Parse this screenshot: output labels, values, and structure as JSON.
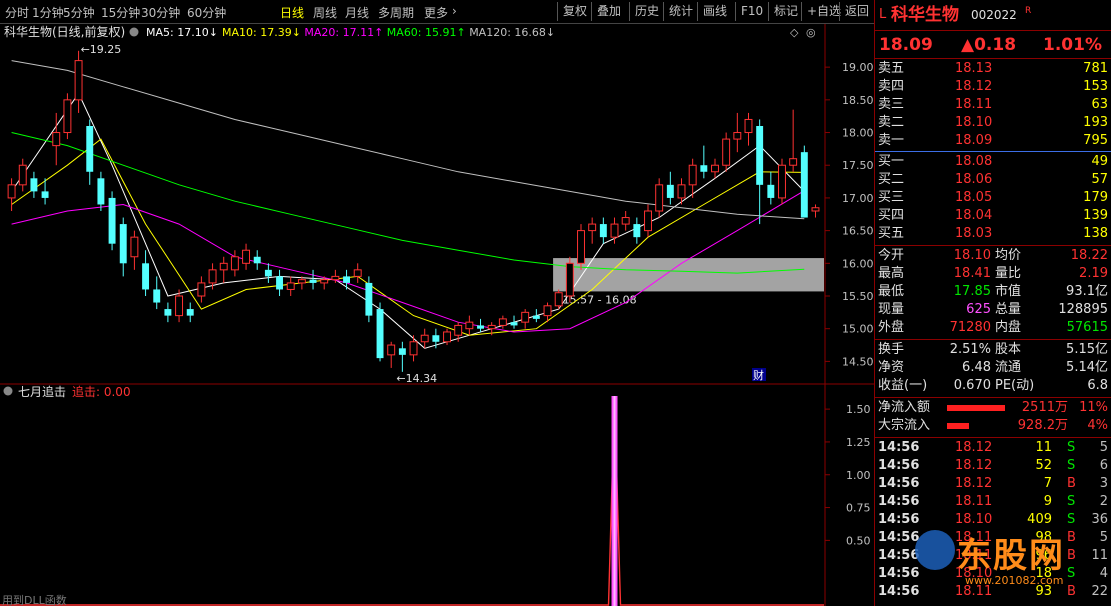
{
  "toolbar": {
    "periods": [
      "分时",
      "1分钟",
      "5分钟",
      "15分钟",
      "30分钟",
      "60分钟",
      "日线",
      "周线",
      "月线",
      "多周期",
      "更多"
    ],
    "active_period": "日线",
    "buttons": [
      "复权",
      "叠加",
      "历史",
      "统计",
      "画线",
      "F10",
      "标记",
      "+自选",
      "返回"
    ]
  },
  "main_chart": {
    "stock_title": "科华生物(日线,前复权)",
    "ma": [
      {
        "label": "MA5: 17.10",
        "color": "#ffffff",
        "arrow": "↓"
      },
      {
        "label": "MA10: 17.39",
        "color": "#ffff00",
        "arrow": "↓"
      },
      {
        "label": "MA20: 17.11",
        "color": "#ff00ff",
        "arrow": "↑"
      },
      {
        "label": "MA60: 15.91",
        "color": "#00ff00",
        "arrow": "↑"
      },
      {
        "label": "MA120: 16.68",
        "color": "#c0c0c0",
        "arrow": "↓"
      }
    ],
    "high_marker": "19.25",
    "low_marker": "14.34",
    "zone_label": "15.57 - 16.08",
    "cai_marker": "财",
    "y_ticks": [
      "19.00",
      "18.50",
      "18.00",
      "17.50",
      "17.00",
      "16.50",
      "16.00",
      "15.50",
      "15.00",
      "14.50"
    ]
  },
  "sub_chart": {
    "name": "七月追击",
    "var_label": "追击: 0.00",
    "y_ticks": [
      "1.50",
      "1.25",
      "1.00",
      "0.75",
      "0.50"
    ],
    "bottom_text": "用到DLL函数"
  },
  "chart_data": {
    "type": "candlestick",
    "ylim": [
      14.2,
      19.4
    ],
    "candles": [
      [
        17.0,
        17.3,
        16.8,
        17.2
      ],
      [
        17.2,
        17.6,
        17.1,
        17.5
      ],
      [
        17.3,
        17.4,
        17.0,
        17.1
      ],
      [
        17.1,
        17.3,
        16.9,
        17.0
      ],
      [
        17.8,
        18.3,
        17.5,
        18.0
      ],
      [
        18.0,
        18.6,
        17.9,
        18.5
      ],
      [
        18.5,
        19.25,
        18.3,
        19.1
      ],
      [
        18.1,
        18.2,
        17.2,
        17.4
      ],
      [
        17.3,
        17.4,
        16.8,
        16.9
      ],
      [
        17.0,
        17.1,
        16.2,
        16.3
      ],
      [
        16.6,
        16.7,
        15.8,
        16.0
      ],
      [
        16.1,
        16.5,
        15.9,
        16.4
      ],
      [
        16.0,
        16.2,
        15.5,
        15.6
      ],
      [
        15.6,
        15.8,
        15.3,
        15.4
      ],
      [
        15.3,
        15.4,
        15.1,
        15.2
      ],
      [
        15.2,
        15.6,
        15.1,
        15.5
      ],
      [
        15.3,
        15.4,
        15.1,
        15.2
      ],
      [
        15.5,
        15.8,
        15.4,
        15.7
      ],
      [
        15.7,
        16.0,
        15.6,
        15.9
      ],
      [
        15.9,
        16.1,
        15.7,
        16.0
      ],
      [
        15.9,
        16.2,
        15.8,
        16.1
      ],
      [
        16.0,
        16.3,
        15.9,
        16.2
      ],
      [
        16.1,
        16.2,
        15.9,
        16.0
      ],
      [
        15.9,
        16.0,
        15.7,
        15.8
      ],
      [
        15.8,
        15.9,
        15.5,
        15.6
      ],
      [
        15.6,
        15.8,
        15.5,
        15.7
      ],
      [
        15.7,
        15.8,
        15.6,
        15.75
      ],
      [
        15.75,
        15.9,
        15.6,
        15.7
      ],
      [
        15.7,
        15.8,
        15.6,
        15.75
      ],
      [
        15.75,
        15.9,
        15.7,
        15.8
      ],
      [
        15.8,
        15.9,
        15.6,
        15.7
      ],
      [
        15.8,
        16.0,
        15.7,
        15.9
      ],
      [
        15.7,
        15.8,
        15.1,
        15.2
      ],
      [
        15.3,
        15.4,
        14.5,
        14.55
      ],
      [
        14.6,
        14.8,
        14.4,
        14.75
      ],
      [
        14.7,
        14.8,
        14.34,
        14.6
      ],
      [
        14.6,
        14.9,
        14.5,
        14.8
      ],
      [
        14.8,
        15.0,
        14.7,
        14.9
      ],
      [
        14.9,
        15.0,
        14.7,
        14.8
      ],
      [
        14.8,
        15.0,
        14.75,
        14.95
      ],
      [
        14.9,
        15.1,
        14.8,
        15.05
      ],
      [
        15.0,
        15.2,
        14.9,
        15.1
      ],
      [
        15.05,
        15.15,
        14.95,
        15.0
      ],
      [
        15.0,
        15.1,
        14.9,
        15.05
      ],
      [
        15.05,
        15.2,
        15.0,
        15.15
      ],
      [
        15.1,
        15.2,
        15.0,
        15.05
      ],
      [
        15.1,
        15.3,
        15.0,
        15.25
      ],
      [
        15.2,
        15.3,
        15.1,
        15.15
      ],
      [
        15.2,
        15.4,
        15.1,
        15.35
      ],
      [
        15.35,
        15.6,
        15.3,
        15.55
      ],
      [
        15.5,
        16.1,
        15.4,
        16.0
      ],
      [
        16.0,
        16.6,
        15.9,
        16.5
      ],
      [
        16.5,
        16.7,
        16.3,
        16.6
      ],
      [
        16.6,
        16.7,
        16.3,
        16.4
      ],
      [
        16.4,
        16.7,
        16.3,
        16.6
      ],
      [
        16.6,
        16.8,
        16.5,
        16.7
      ],
      [
        16.6,
        16.7,
        16.3,
        16.4
      ],
      [
        16.5,
        16.9,
        16.4,
        16.8
      ],
      [
        16.8,
        17.3,
        16.7,
        17.2
      ],
      [
        17.2,
        17.4,
        16.9,
        17.0
      ],
      [
        17.0,
        17.3,
        16.9,
        17.2
      ],
      [
        17.2,
        17.6,
        17.0,
        17.5
      ],
      [
        17.5,
        17.8,
        17.3,
        17.4
      ],
      [
        17.4,
        17.6,
        17.3,
        17.5
      ],
      [
        17.5,
        18.0,
        17.4,
        17.9
      ],
      [
        17.9,
        18.3,
        17.7,
        18.0
      ],
      [
        18.0,
        18.3,
        17.8,
        18.2
      ],
      [
        18.1,
        18.2,
        16.6,
        17.2
      ],
      [
        17.2,
        17.4,
        16.9,
        17.0
      ],
      [
        17.0,
        17.6,
        16.9,
        17.5
      ],
      [
        17.5,
        18.35,
        17.4,
        17.6
      ],
      [
        17.7,
        17.8,
        16.7,
        16.7
      ],
      [
        16.8,
        16.9,
        16.7,
        16.85
      ]
    ],
    "ma_series": [
      {
        "name": "MA5",
        "color": "#ffffff",
        "points": [
          [
            0,
            17.1
          ],
          [
            6,
            18.6
          ],
          [
            9,
            17.5
          ],
          [
            14,
            15.5
          ],
          [
            19,
            15.7
          ],
          [
            24,
            15.8
          ],
          [
            29,
            15.75
          ],
          [
            33,
            15.3
          ],
          [
            37,
            14.7
          ],
          [
            43,
            15.0
          ],
          [
            49,
            15.3
          ],
          [
            53,
            16.3
          ],
          [
            58,
            16.7
          ],
          [
            63,
            17.3
          ],
          [
            67,
            17.8
          ],
          [
            71,
            17.1
          ]
        ]
      },
      {
        "name": "MA10",
        "color": "#ffff00",
        "points": [
          [
            0,
            16.9
          ],
          [
            5,
            17.5
          ],
          [
            8,
            17.9
          ],
          [
            12,
            16.6
          ],
          [
            17,
            15.3
          ],
          [
            21,
            15.6
          ],
          [
            26,
            15.7
          ],
          [
            31,
            15.8
          ],
          [
            36,
            15.2
          ],
          [
            41,
            14.9
          ],
          [
            47,
            15.0
          ],
          [
            52,
            15.6
          ],
          [
            57,
            16.4
          ],
          [
            62,
            16.9
          ],
          [
            67,
            17.4
          ],
          [
            71,
            17.39
          ]
        ]
      },
      {
        "name": "MA20",
        "color": "#ff00ff",
        "points": [
          [
            0,
            16.6
          ],
          [
            5,
            16.8
          ],
          [
            10,
            16.9
          ],
          [
            15,
            16.6
          ],
          [
            20,
            16.1
          ],
          [
            25,
            15.9
          ],
          [
            30,
            15.7
          ],
          [
            35,
            15.4
          ],
          [
            40,
            15.1
          ],
          [
            45,
            14.95
          ],
          [
            50,
            15.0
          ],
          [
            55,
            15.4
          ],
          [
            60,
            16.0
          ],
          [
            65,
            16.5
          ],
          [
            71,
            17.11
          ]
        ]
      },
      {
        "name": "MA60",
        "color": "#00ff00",
        "points": [
          [
            0,
            18.0
          ],
          [
            5,
            17.8
          ],
          [
            10,
            17.5
          ],
          [
            15,
            17.2
          ],
          [
            20,
            16.95
          ],
          [
            25,
            16.75
          ],
          [
            30,
            16.55
          ],
          [
            35,
            16.35
          ],
          [
            40,
            16.2
          ],
          [
            45,
            16.05
          ],
          [
            50,
            15.95
          ],
          [
            55,
            15.9
          ],
          [
            60,
            15.88
          ],
          [
            65,
            15.85
          ],
          [
            71,
            15.91
          ]
        ]
      },
      {
        "name": "MA120",
        "color": "#c0c0c0",
        "points": [
          [
            0,
            19.1
          ],
          [
            5,
            18.95
          ],
          [
            10,
            18.7
          ],
          [
            15,
            18.45
          ],
          [
            20,
            18.2
          ],
          [
            25,
            18.0
          ],
          [
            30,
            17.8
          ],
          [
            35,
            17.6
          ],
          [
            40,
            17.4
          ],
          [
            45,
            17.25
          ],
          [
            50,
            17.1
          ],
          [
            55,
            16.95
          ],
          [
            60,
            16.85
          ],
          [
            65,
            16.75
          ],
          [
            71,
            16.68
          ]
        ]
      }
    ],
    "zone": {
      "low": 15.57,
      "high": 16.08,
      "start_index": 49
    },
    "indicator": {
      "ylim": [
        0,
        1.6
      ],
      "spike_index": 54,
      "spike_value": 1.6
    }
  },
  "quote": {
    "prefix": "L",
    "name": "科华生物",
    "code": "002022",
    "suffix": "R",
    "price": "18.09",
    "change": "▲0.18",
    "pct": "1.01%",
    "asks": [
      {
        "label": "卖五",
        "price": "18.13",
        "vol": "781"
      },
      {
        "label": "卖四",
        "price": "18.12",
        "vol": "153"
      },
      {
        "label": "卖三",
        "price": "18.11",
        "vol": "63"
      },
      {
        "label": "卖二",
        "price": "18.10",
        "vol": "193"
      },
      {
        "label": "卖一",
        "price": "18.09",
        "vol": "795"
      }
    ],
    "bids": [
      {
        "label": "买一",
        "price": "18.08",
        "vol": "49"
      },
      {
        "label": "买二",
        "price": "18.06",
        "vol": "57"
      },
      {
        "label": "买三",
        "price": "18.05",
        "vol": "179"
      },
      {
        "label": "买四",
        "price": "18.04",
        "vol": "139"
      },
      {
        "label": "买五",
        "price": "18.03",
        "vol": "138"
      }
    ],
    "stats": [
      {
        "l1": "今开",
        "v1": "18.10",
        "c1": "red",
        "l2": "均价",
        "v2": "18.22",
        "c2": "red"
      },
      {
        "l1": "最高",
        "v1": "18.41",
        "c1": "red",
        "l2": "量比",
        "v2": "2.19",
        "c2": "red"
      },
      {
        "l1": "最低",
        "v1": "17.85",
        "c1": "green",
        "l2": "市值",
        "v2": "93.1亿",
        "c2": "white"
      },
      {
        "l1": "现量",
        "v1": "625",
        "c1": "mag",
        "l2": "总量",
        "v2": "128895",
        "c2": "white"
      },
      {
        "l1": "外盘",
        "v1": "71280",
        "c1": "red",
        "l2": "内盘",
        "v2": "57615",
        "c2": "green"
      }
    ],
    "stats2": [
      {
        "l1": "换手",
        "v1": "2.51%",
        "l2": "股本",
        "v2": "5.15亿"
      },
      {
        "l1": "净资",
        "v1": "6.48",
        "l2": "流通",
        "v2": "5.14亿"
      },
      {
        "l1": "收益(一)",
        "v1": "0.670",
        "l2": "PE(动)",
        "v2": "6.8"
      }
    ],
    "flows": [
      {
        "label": "净流入额",
        "value": "2511万",
        "pct": "11%",
        "bar": 0.8
      },
      {
        "label": "大宗流入",
        "value": "928.2万",
        "pct": "4%",
        "bar": 0.3
      }
    ],
    "ticks": [
      {
        "time": "14:56",
        "price": "18.12",
        "vol": "11",
        "side": "S",
        "n": "5"
      },
      {
        "time": "14:56",
        "price": "18.12",
        "vol": "52",
        "side": "S",
        "n": "6"
      },
      {
        "time": "14:56",
        "price": "18.12",
        "vol": "7",
        "side": "B",
        "n": "3"
      },
      {
        "time": "14:56",
        "price": "18.11",
        "vol": "9",
        "side": "S",
        "n": "2"
      },
      {
        "time": "14:56",
        "price": "18.10",
        "vol": "409",
        "side": "S",
        "n": "36"
      },
      {
        "time": "14:56",
        "price": "18.11",
        "vol": "98",
        "side": "B",
        "n": "5"
      },
      {
        "time": "14:56",
        "price": "18.11",
        "vol": "96",
        "side": "B",
        "n": "11"
      },
      {
        "time": "14:56",
        "price": "18.10",
        "vol": "18",
        "side": "S",
        "n": "4"
      },
      {
        "time": "14:56",
        "price": "18.11",
        "vol": "93",
        "side": "B",
        "n": "22"
      }
    ]
  },
  "watermark": {
    "logo_text": "东股网",
    "url": "www.201082.com"
  }
}
